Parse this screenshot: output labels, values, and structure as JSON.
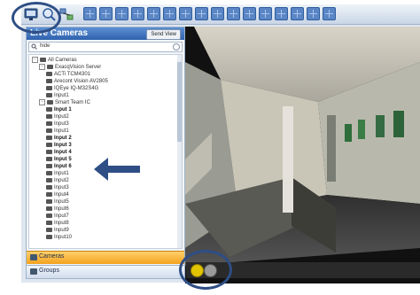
{
  "panel": {
    "title": "Live Cameras",
    "send_view_label": "Send View"
  },
  "search": {
    "value": "hide"
  },
  "tree": {
    "items": [
      {
        "label": "All Cameras",
        "level": 0,
        "expander": "-"
      },
      {
        "label": "ExacqVision Server",
        "level": 1,
        "expander": "-"
      },
      {
        "label": "ACTi TCM4301",
        "level": 2
      },
      {
        "label": "Arecont Vision AV2805",
        "level": 2
      },
      {
        "label": "IQEye IQ-M32S4G",
        "level": 2
      },
      {
        "label": "Input1",
        "level": 2
      },
      {
        "label": "Smart Team IC",
        "level": 1,
        "expander": "-"
      },
      {
        "label": "Input 1",
        "level": 2,
        "bold": true
      },
      {
        "label": "Input2",
        "level": 2
      },
      {
        "label": "Input3",
        "level": 2
      },
      {
        "label": "Input1",
        "level": 2
      },
      {
        "label": "Input 2",
        "level": 2,
        "bold": true
      },
      {
        "label": "Input 3",
        "level": 2,
        "bold": true
      },
      {
        "label": "Input 4",
        "level": 2,
        "bold": true
      },
      {
        "label": "Input 5",
        "level": 2,
        "bold": true
      },
      {
        "label": "Input 6",
        "level": 2,
        "bold": true
      },
      {
        "label": "Input1",
        "level": 2
      },
      {
        "label": "Input2",
        "level": 2
      },
      {
        "label": "Input3",
        "level": 2
      },
      {
        "label": "Input4",
        "level": 2
      },
      {
        "label": "Input5",
        "level": 2
      },
      {
        "label": "Input6",
        "level": 2
      },
      {
        "label": "Input7",
        "level": 2
      },
      {
        "label": "Input8",
        "level": 2
      },
      {
        "label": "Input9",
        "level": 2
      },
      {
        "label": "Input10",
        "level": 2
      }
    ]
  },
  "tabs": {
    "cameras_label": "Cameras",
    "groups_label": "Groups"
  },
  "toolbar": {
    "icons": [
      "monitor-icon",
      "search-camera-icon",
      "network-icon"
    ],
    "layout_buttons": 16
  },
  "colors": {
    "accent": "#2f62ad",
    "annotation": "#2e4e85",
    "tab_active": "#f3a21e"
  }
}
